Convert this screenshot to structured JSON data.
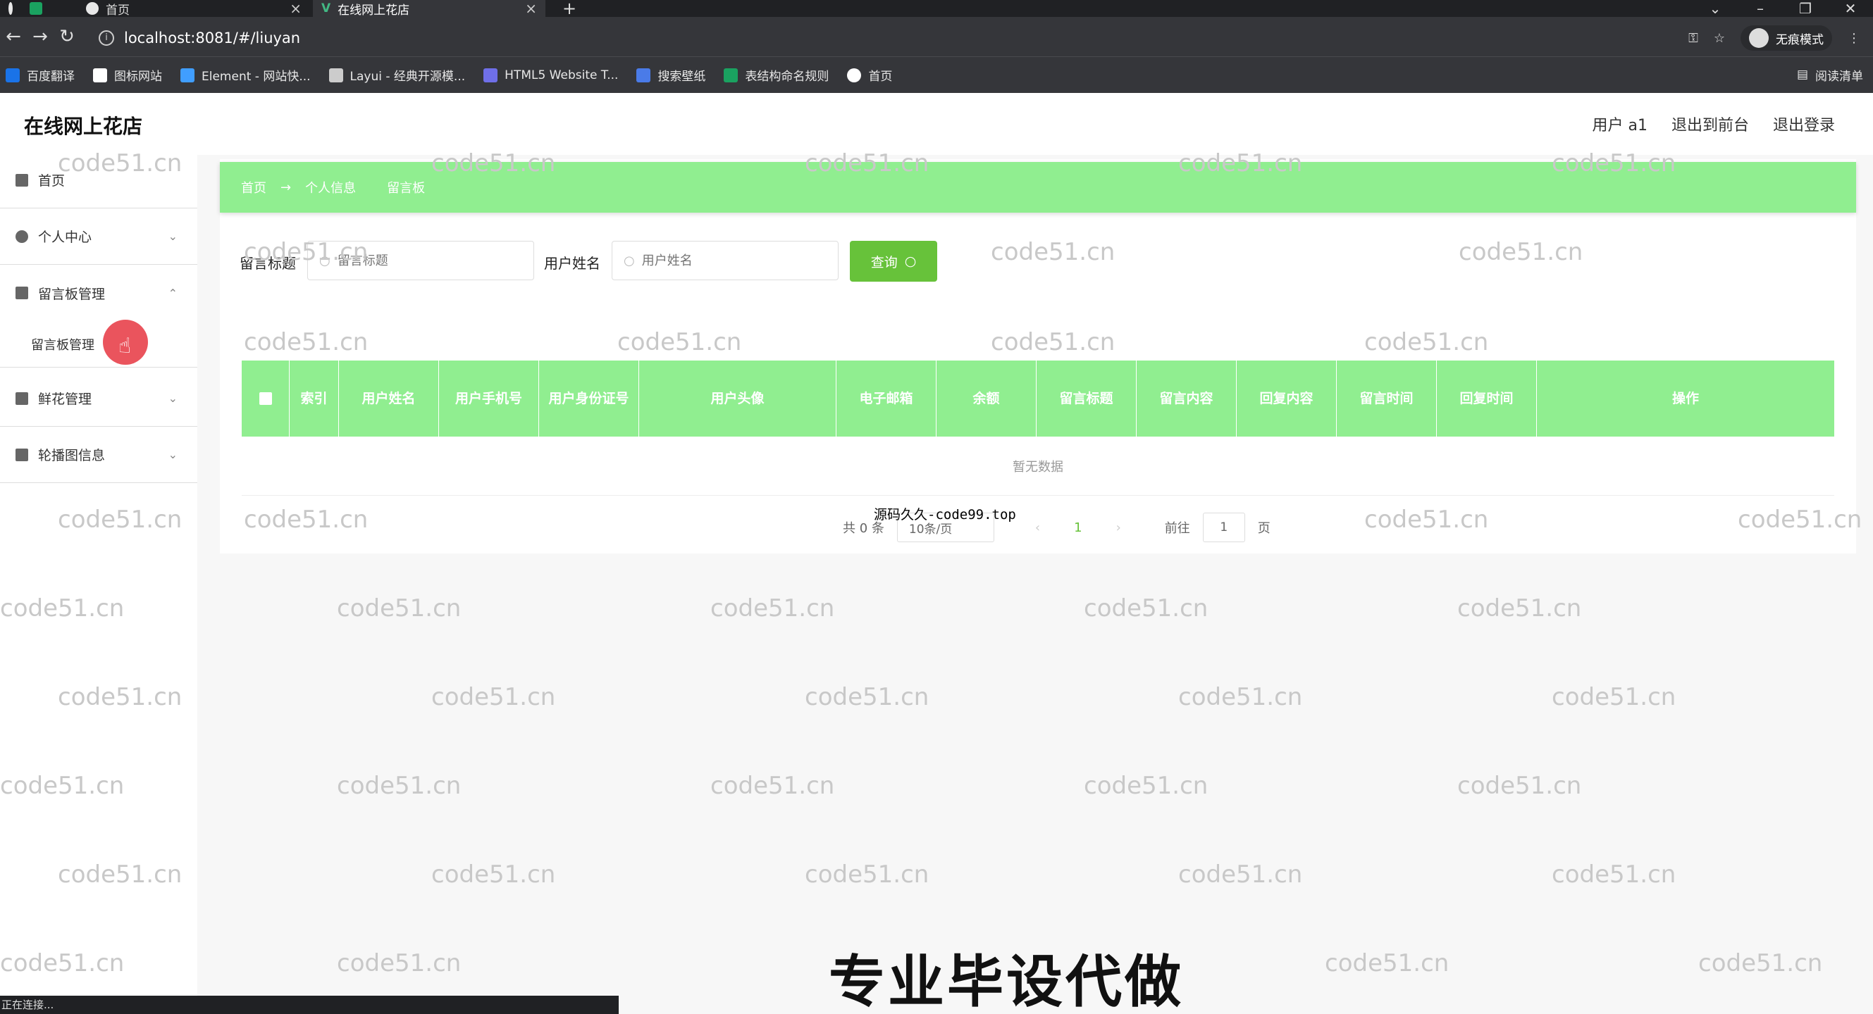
{
  "browser": {
    "tabs": [
      {
        "label": ""
      },
      {
        "label": ""
      },
      {
        "label": "首页"
      },
      {
        "label": "在线网上花店"
      }
    ],
    "new_tab": "+",
    "url": "localhost:8081/#/liuyan",
    "incognito_label": "无痕模式",
    "bookmarks": [
      {
        "label": "百度翻译",
        "color": "#1a73e8"
      },
      {
        "label": "图标网站",
        "color": "#ffffff"
      },
      {
        "label": "Element - 网站快...",
        "color": "#409eff"
      },
      {
        "label": "Layui - 经典开源模...",
        "color": "#cccccc"
      },
      {
        "label": "HTML5 Website T...",
        "color": "#6f6fe8"
      },
      {
        "label": "搜索壁纸",
        "color": "#4a7be8"
      },
      {
        "label": "表结构命名规则",
        "color": "#1aa260"
      },
      {
        "label": "首页",
        "color": "#ffffff"
      }
    ],
    "reading_list": "阅读清单",
    "status_text": "正在连接..."
  },
  "app": {
    "title": "在线网上花店",
    "header_links": {
      "user": "用户 a1",
      "front": "退出到前台",
      "logout": "退出登录"
    },
    "menu": [
      {
        "label": "首页",
        "icon": "home-icon"
      },
      {
        "label": "个人中心",
        "icon": "user-icon"
      },
      {
        "label": "留言板管理",
        "icon": "message-icon"
      },
      {
        "label": "鲜花管理",
        "icon": "grid-icon"
      },
      {
        "label": "轮播图信息",
        "icon": "image-icon"
      }
    ],
    "submenu_active": "留言板管理",
    "breadcrumb": [
      "首页",
      "→",
      "个人信息",
      "留言板"
    ],
    "search": {
      "title_label": "留言标题",
      "title_placeholder": "留言标题",
      "name_label": "用户姓名",
      "name_placeholder": "用户姓名",
      "query_button": "查询"
    },
    "table": {
      "columns": [
        "索引",
        "用户姓名",
        "用户手机号",
        "用户身份证号",
        "用户头像",
        "电子邮箱",
        "余额",
        "留言标题",
        "留言内容",
        "回复内容",
        "留言时间",
        "回复时间",
        "操作"
      ],
      "empty_text": "暂无数据"
    },
    "pagination": {
      "total": "共 0 条",
      "page_size": "10条/页",
      "current_page": "1",
      "goto_label": "前往",
      "goto_value": "1",
      "page_suffix": "页"
    }
  },
  "overlay": {
    "promo_text": "源码久久-code99.top",
    "big_text": "专业毕设代做",
    "watermark": "code51.cn"
  },
  "colors": {
    "accent": "#90ee90",
    "button": "#67c23a"
  }
}
